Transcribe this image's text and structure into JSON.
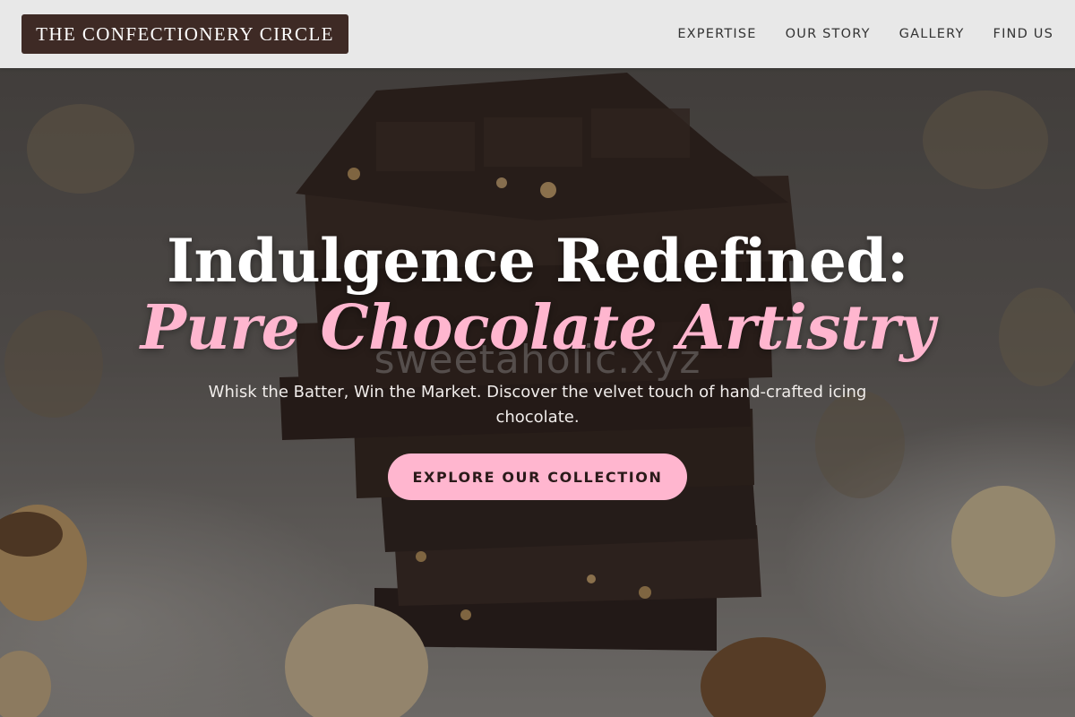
{
  "header": {
    "logo_text": "THE CONFECTIONERY CIRCLE",
    "nav": [
      {
        "label": "EXPERTISE"
      },
      {
        "label": "OUR STORY"
      },
      {
        "label": "GALLERY"
      },
      {
        "label": "FIND US"
      }
    ]
  },
  "hero": {
    "title_line1": "Indulgence Redefined:",
    "title_line2": "Pure Chocolate Artistry",
    "watermark": "sweetaholic.xyz",
    "subtitle": "Whisk the Batter, Win the Market. Discover the velvet touch of hand-crafted icing chocolate.",
    "cta_label": "EXPLORE OUR COLLECTION"
  },
  "colors": {
    "logo_bg": "#3e2a25",
    "accent_pink": "#ffb6cf",
    "header_bg": "#e8e8e8"
  }
}
